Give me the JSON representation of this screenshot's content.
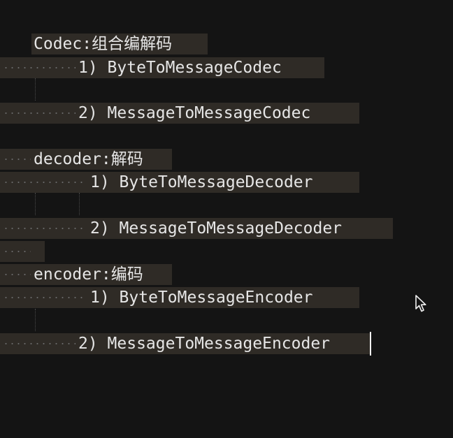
{
  "editor": {
    "lines": [
      {
        "text": "Codec:组合编解码"
      },
      {
        "text": "1) ByteToMessageCodec"
      },
      {
        "text": "2) MessageToMessageCodec"
      },
      {
        "text": "decoder:解码"
      },
      {
        "text": "1) ByteToMessageDecoder"
      },
      {
        "text": "2) MessageToMessageDecoder"
      },
      {
        "text": ""
      },
      {
        "text": "encoder:编码"
      },
      {
        "text": "1) ByteToMessageEncoder"
      },
      {
        "text": "2) MessageToMessageEncoder"
      }
    ]
  },
  "colors": {
    "background": "#141414",
    "line_highlight": "#2f2b26",
    "text": "#e6e6e6",
    "whitespace_dots": "#6a6a6a"
  },
  "icons": {
    "mouse_pointer": "arrow-pointer-icon"
  }
}
